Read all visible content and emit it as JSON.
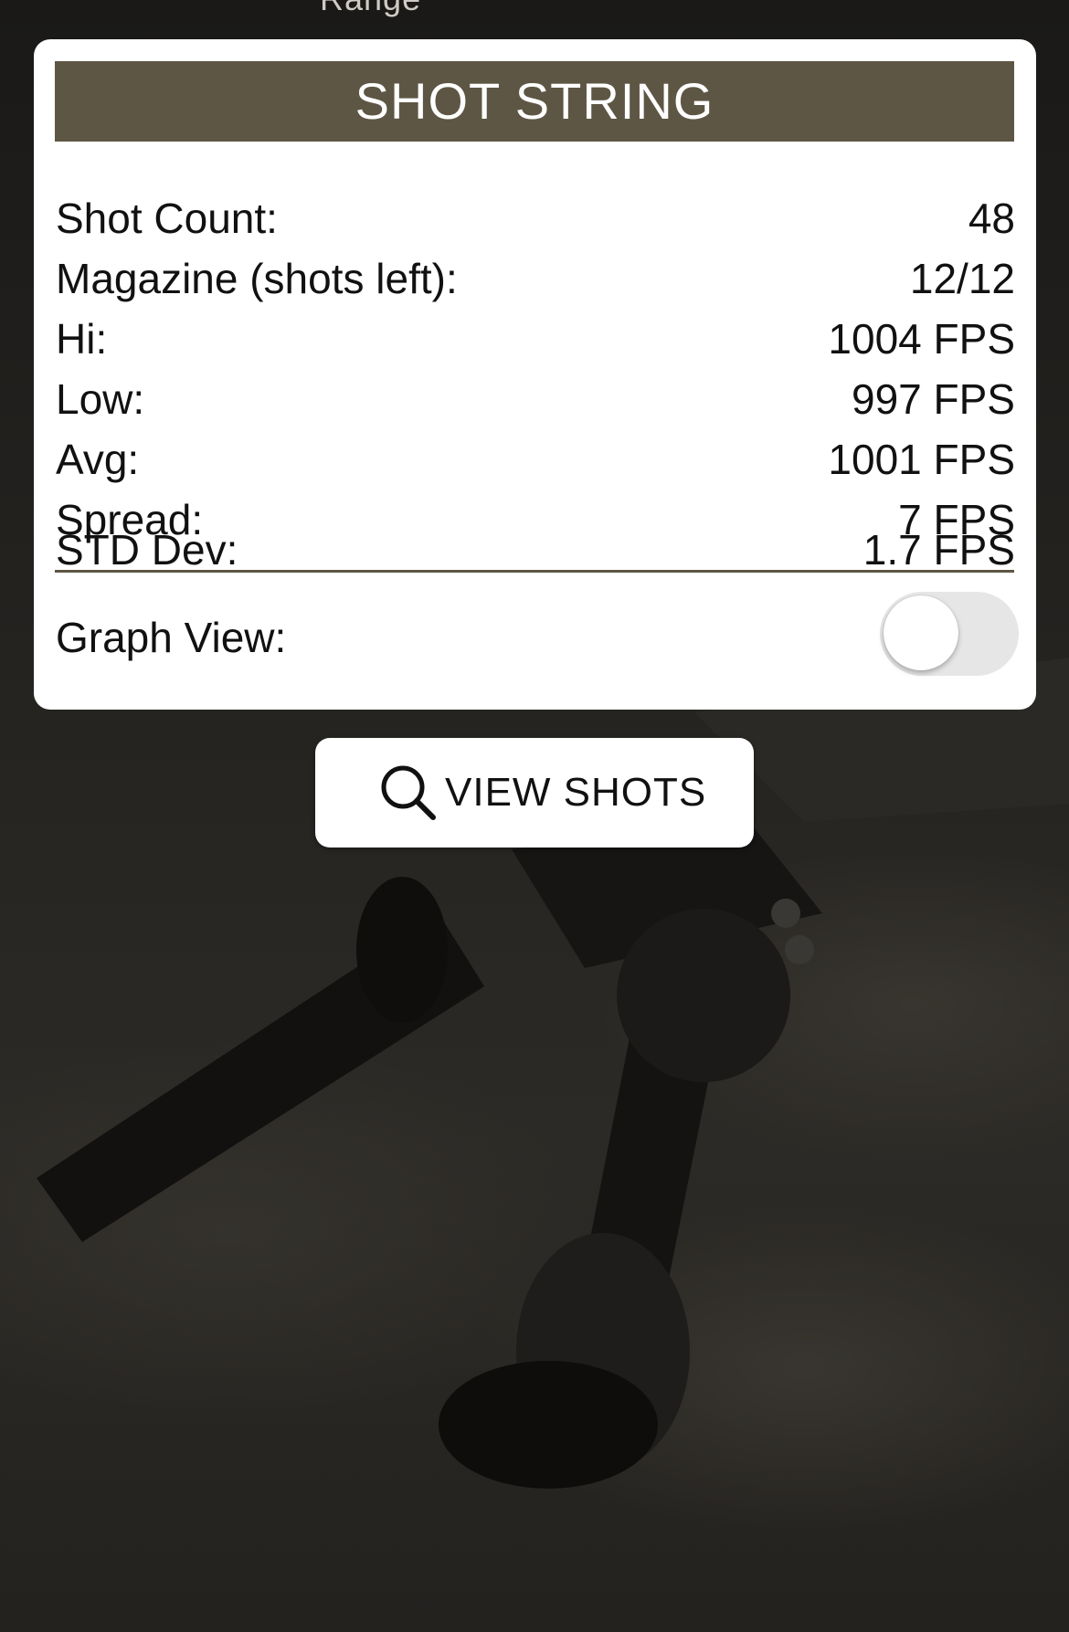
{
  "header_partial_text": "Range",
  "card": {
    "title": "SHOT STRING",
    "stats": [
      {
        "label": "Shot Count:",
        "value": "48"
      },
      {
        "label": "Magazine (shots left):",
        "value": "12/12"
      },
      {
        "label": "Hi:",
        "value": "1004 FPS"
      },
      {
        "label": "Low:",
        "value": "997 FPS"
      },
      {
        "label": "Avg:",
        "value": "1001 FPS"
      },
      {
        "label": "Spread:",
        "value": "7 FPS"
      },
      {
        "label": "STD Dev:",
        "value": "1.7 FPS"
      }
    ],
    "graph_view": {
      "label": "Graph View:",
      "enabled": false
    }
  },
  "view_shots_button": {
    "label": "VIEW SHOTS",
    "icon": "search-icon"
  },
  "colors": {
    "header_bg": "#5e5644",
    "card_bg": "#ffffff",
    "toggle_off": "#e6e6e7"
  }
}
